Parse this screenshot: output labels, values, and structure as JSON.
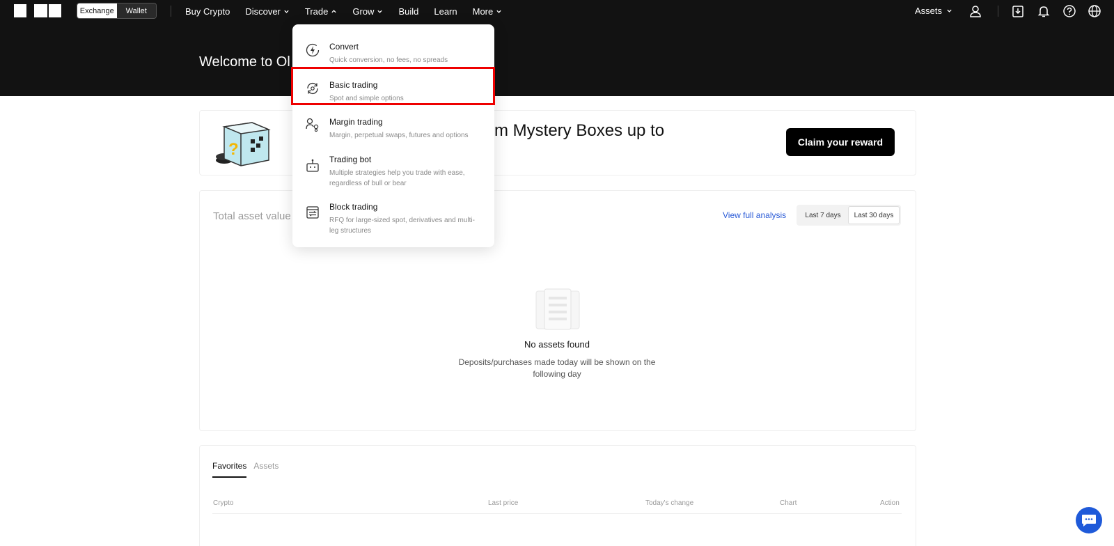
{
  "header": {
    "mode_switch": {
      "exchange": "Exchange",
      "wallet": "Wallet"
    },
    "nav": [
      {
        "label": "Buy Crypto",
        "has_chevron": false
      },
      {
        "label": "Discover",
        "has_chevron": true
      },
      {
        "label": "Trade",
        "has_chevron": true,
        "open": true
      },
      {
        "label": "Grow",
        "has_chevron": true
      },
      {
        "label": "Build",
        "has_chevron": false
      },
      {
        "label": "Learn",
        "has_chevron": false
      },
      {
        "label": "More",
        "has_chevron": true
      }
    ],
    "assets_label": "Assets",
    "icons": [
      "user-icon",
      "download-icon",
      "bell-icon",
      "help-icon",
      "globe-icon"
    ]
  },
  "hero": {
    "welcome": "Welcome to Ol"
  },
  "banner": {
    "text": "laim Mystery Boxes up to",
    "cta": "Claim your reward"
  },
  "asset_card": {
    "title": "Total asset value",
    "view_analysis": "View full analysis",
    "range_options": [
      "Last 7 days",
      "Last 30 days"
    ],
    "selected_range": "Last 30 days",
    "empty_title": "No assets found",
    "empty_desc": "Deposits/purchases made today will be shown on the following day"
  },
  "favorites": {
    "tabs": [
      "Favorites",
      "Assets"
    ],
    "active_tab": "Favorites",
    "columns": [
      "Crypto",
      "Last price",
      "Today's change",
      "Chart",
      "Action"
    ]
  },
  "trade_menu": {
    "items": [
      {
        "title": "Convert",
        "desc": "Quick conversion, no fees, no spreads",
        "icon": "convert-icon"
      },
      {
        "title": "Basic trading",
        "desc": "Spot and simple options",
        "icon": "basic-trading-icon",
        "highlighted": true
      },
      {
        "title": "Margin trading",
        "desc": "Margin, perpetual swaps, futures and options",
        "icon": "margin-trading-icon"
      },
      {
        "title": "Trading bot",
        "desc": "Multiple strategies help you trade with ease, regardless of bull or bear",
        "icon": "robot-icon"
      },
      {
        "title": "Block trading",
        "desc": "RFQ for large-sized spot, derivatives and multi-leg structures",
        "icon": "block-trading-icon"
      }
    ]
  },
  "colors": {
    "nav_bg": "#121212",
    "accent_blue": "#2a5bd7",
    "chat_blue": "#1f5ad9",
    "highlight_red": "#e00000"
  }
}
